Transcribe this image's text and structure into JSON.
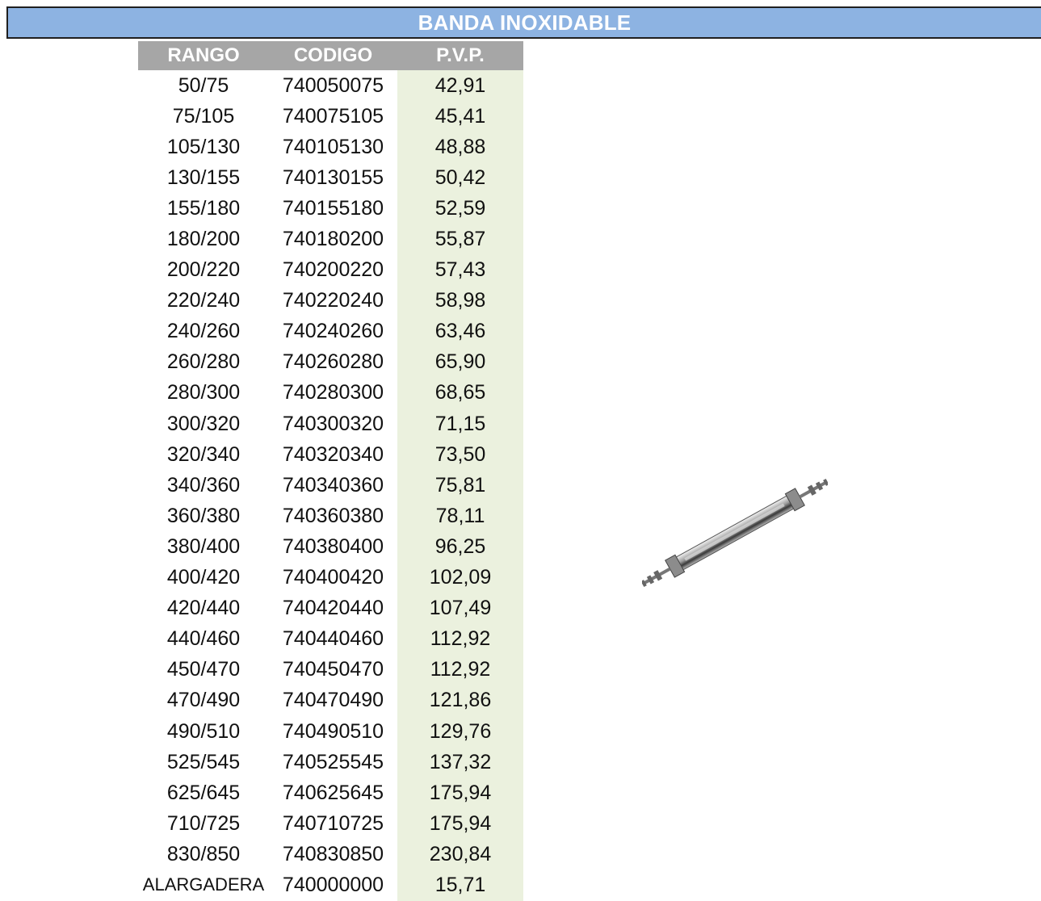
{
  "title": "BANDA INOXIDABLE",
  "columns": {
    "rango": "RANGO",
    "codigo": "CODIGO",
    "pvp": "P.V.P."
  },
  "rows": [
    {
      "rango": "50/75",
      "codigo": "740050075",
      "pvp": "42,91"
    },
    {
      "rango": "75/105",
      "codigo": "740075105",
      "pvp": "45,41"
    },
    {
      "rango": "105/130",
      "codigo": "740105130",
      "pvp": "48,88"
    },
    {
      "rango": "130/155",
      "codigo": "740130155",
      "pvp": "50,42"
    },
    {
      "rango": "155/180",
      "codigo": "740155180",
      "pvp": "52,59"
    },
    {
      "rango": "180/200",
      "codigo": "740180200",
      "pvp": "55,87"
    },
    {
      "rango": "200/220",
      "codigo": "740200220",
      "pvp": "57,43"
    },
    {
      "rango": "220/240",
      "codigo": "740220240",
      "pvp": "58,98"
    },
    {
      "rango": "240/260",
      "codigo": "740240260",
      "pvp": "63,46"
    },
    {
      "rango": "260/280",
      "codigo": "740260280",
      "pvp": "65,90"
    },
    {
      "rango": "280/300",
      "codigo": "740280300",
      "pvp": "68,65"
    },
    {
      "rango": "300/320",
      "codigo": "740300320",
      "pvp": "71,15"
    },
    {
      "rango": "320/340",
      "codigo": "740320340",
      "pvp": "73,50"
    },
    {
      "rango": "340/360",
      "codigo": "740340360",
      "pvp": "75,81"
    },
    {
      "rango": "360/380",
      "codigo": "740360380",
      "pvp": "78,11"
    },
    {
      "rango": "380/400",
      "codigo": "740380400",
      "pvp": "96,25"
    },
    {
      "rango": "400/420",
      "codigo": "740400420",
      "pvp": "102,09"
    },
    {
      "rango": "420/440",
      "codigo": "740420440",
      "pvp": "107,49"
    },
    {
      "rango": "440/460",
      "codigo": "740440460",
      "pvp": "112,92"
    },
    {
      "rango": "450/470",
      "codigo": "740450470",
      "pvp": "112,92"
    },
    {
      "rango": "470/490",
      "codigo": "740470490",
      "pvp": "121,86"
    },
    {
      "rango": "490/510",
      "codigo": "740490510",
      "pvp": "129,76"
    },
    {
      "rango": "525/545",
      "codigo": "740525545",
      "pvp": "137,32"
    },
    {
      "rango": "625/645",
      "codigo": "740625645",
      "pvp": "175,94"
    },
    {
      "rango": "710/725",
      "codigo": "740710725",
      "pvp": "175,94"
    },
    {
      "rango": "830/850",
      "codigo": "740830850",
      "pvp": "230,84"
    },
    {
      "rango": "ALARGADERA",
      "codigo": "740000000",
      "pvp": "15,71"
    }
  ],
  "colors": {
    "title_bg": "#8db3e2",
    "header_bg": "#a6a6a6",
    "price_bg": "#ebf1de"
  },
  "image": {
    "icon": "stainless-band-clamp-icon"
  }
}
